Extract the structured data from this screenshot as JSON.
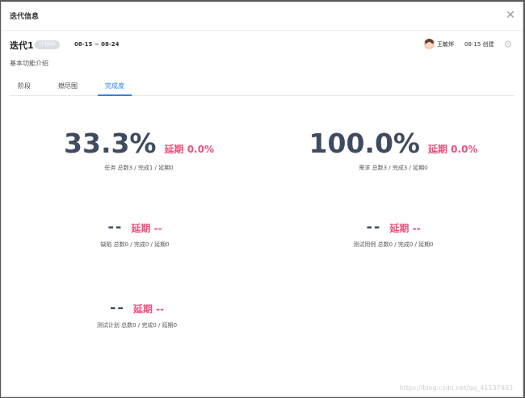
{
  "dialog": {
    "title": "迭代信息",
    "close_icon": "close-icon"
  },
  "iteration": {
    "name": "迭代1",
    "status": "计划中",
    "date_range": "08-15 ~ 08-24",
    "creator": "王敏烨",
    "created": "08-15 创建",
    "description": "基本功能介绍"
  },
  "tabs": [
    {
      "label": "阶段"
    },
    {
      "label": "燃尽图"
    },
    {
      "label": "完成度",
      "active": true
    }
  ],
  "metrics": [
    {
      "value": "33.3%",
      "delay": "延期 0.0%",
      "sub": "任务 总数3 / 完成1 / 延期0"
    },
    {
      "value": "100.0%",
      "delay": "延期 0.0%",
      "sub": "需求 总数3 / 完成3 / 延期0"
    },
    {
      "value": "--",
      "delay": "延期 --",
      "sub": "缺陷 总数0 / 完成0 / 延期0"
    },
    {
      "value": "--",
      "delay": "延期 --",
      "sub": "测试用例 总数0 / 完成0 / 延期0"
    },
    {
      "value": "--",
      "delay": "延期 --",
      "sub": "测试计划 总数0 / 完成0 / 延期0"
    }
  ],
  "watermark": "https://blog.csdn.net/qq_41137403",
  "colors": {
    "accent": "#2f80ed",
    "delay": "#ef4d7a",
    "value": "#3f4b61"
  }
}
